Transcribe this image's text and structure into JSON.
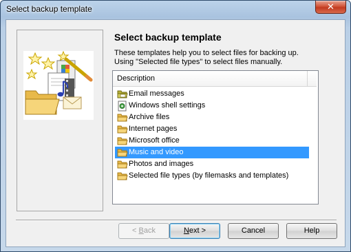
{
  "window": {
    "title": "Select backup template",
    "close_glyph": "✕"
  },
  "main": {
    "heading": "Select backup template",
    "description_line1": "These templates help you to select files for backing up.",
    "description_line2": "Using \"Selected file types\" to select files manually."
  },
  "list": {
    "column_header": "Description",
    "selected_index": 5,
    "items": [
      {
        "label": "Email messages",
        "icon": "email-folder-icon"
      },
      {
        "label": "Windows shell settings",
        "icon": "settings-doc-icon"
      },
      {
        "label": "Archive files",
        "icon": "folder-icon"
      },
      {
        "label": "Internet pages",
        "icon": "folder-icon"
      },
      {
        "label": "Microsoft office",
        "icon": "folder-icon"
      },
      {
        "label": "Music and video",
        "icon": "folder-icon"
      },
      {
        "label": "Photos and images",
        "icon": "folder-icon"
      },
      {
        "label": "Selected file types (by filemasks and templates)",
        "icon": "folder-icon"
      }
    ]
  },
  "buttons": {
    "back_prefix": "< ",
    "back_mnemonic": "B",
    "back_rest": "ack",
    "next_mnemonic": "N",
    "next_rest": "ext >",
    "cancel": "Cancel",
    "help": "Help"
  },
  "colors": {
    "selection": "#3399ff",
    "title_bar": "#b9d1ea",
    "close_button": "#c94a2c"
  }
}
